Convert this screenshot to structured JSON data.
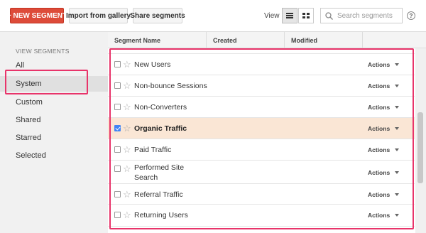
{
  "toolbar": {
    "new_segment": "+ NEW SEGMENT",
    "import_gallery": "Import from gallery",
    "share_segments": "Share segments",
    "view_label": "View",
    "search_placeholder": "Search segments",
    "help": "?"
  },
  "sidebar": {
    "heading": "VIEW SEGMENTS",
    "items": [
      {
        "label": "All",
        "active": false
      },
      {
        "label": "System",
        "active": true
      },
      {
        "label": "Custom",
        "active": false
      },
      {
        "label": "Shared",
        "active": false
      },
      {
        "label": "Starred",
        "active": false
      },
      {
        "label": "Selected",
        "active": false
      }
    ]
  },
  "table": {
    "columns": [
      "Segment Name",
      "Created",
      "Modified",
      ""
    ],
    "rows": [
      {
        "name": "New Users",
        "checked": false,
        "actions": "Actions"
      },
      {
        "name": "Non-bounce Sessions",
        "checked": false,
        "actions": "Actions"
      },
      {
        "name": "Non-Converters",
        "checked": false,
        "actions": "Actions"
      },
      {
        "name": "Organic Traffic",
        "checked": true,
        "actions": "Actions"
      },
      {
        "name": "Paid Traffic",
        "checked": false,
        "actions": "Actions"
      },
      {
        "name": "Performed Site Search",
        "checked": false,
        "actions": "Actions"
      },
      {
        "name": "Referral Traffic",
        "checked": false,
        "actions": "Actions"
      },
      {
        "name": "Returning Users",
        "checked": false,
        "actions": "Actions"
      }
    ]
  },
  "colors": {
    "primary_button": "#dd4b39",
    "highlight": "#e8346a",
    "selected_row": "#fae6d5",
    "checkbox_checked": "#4285f4"
  }
}
